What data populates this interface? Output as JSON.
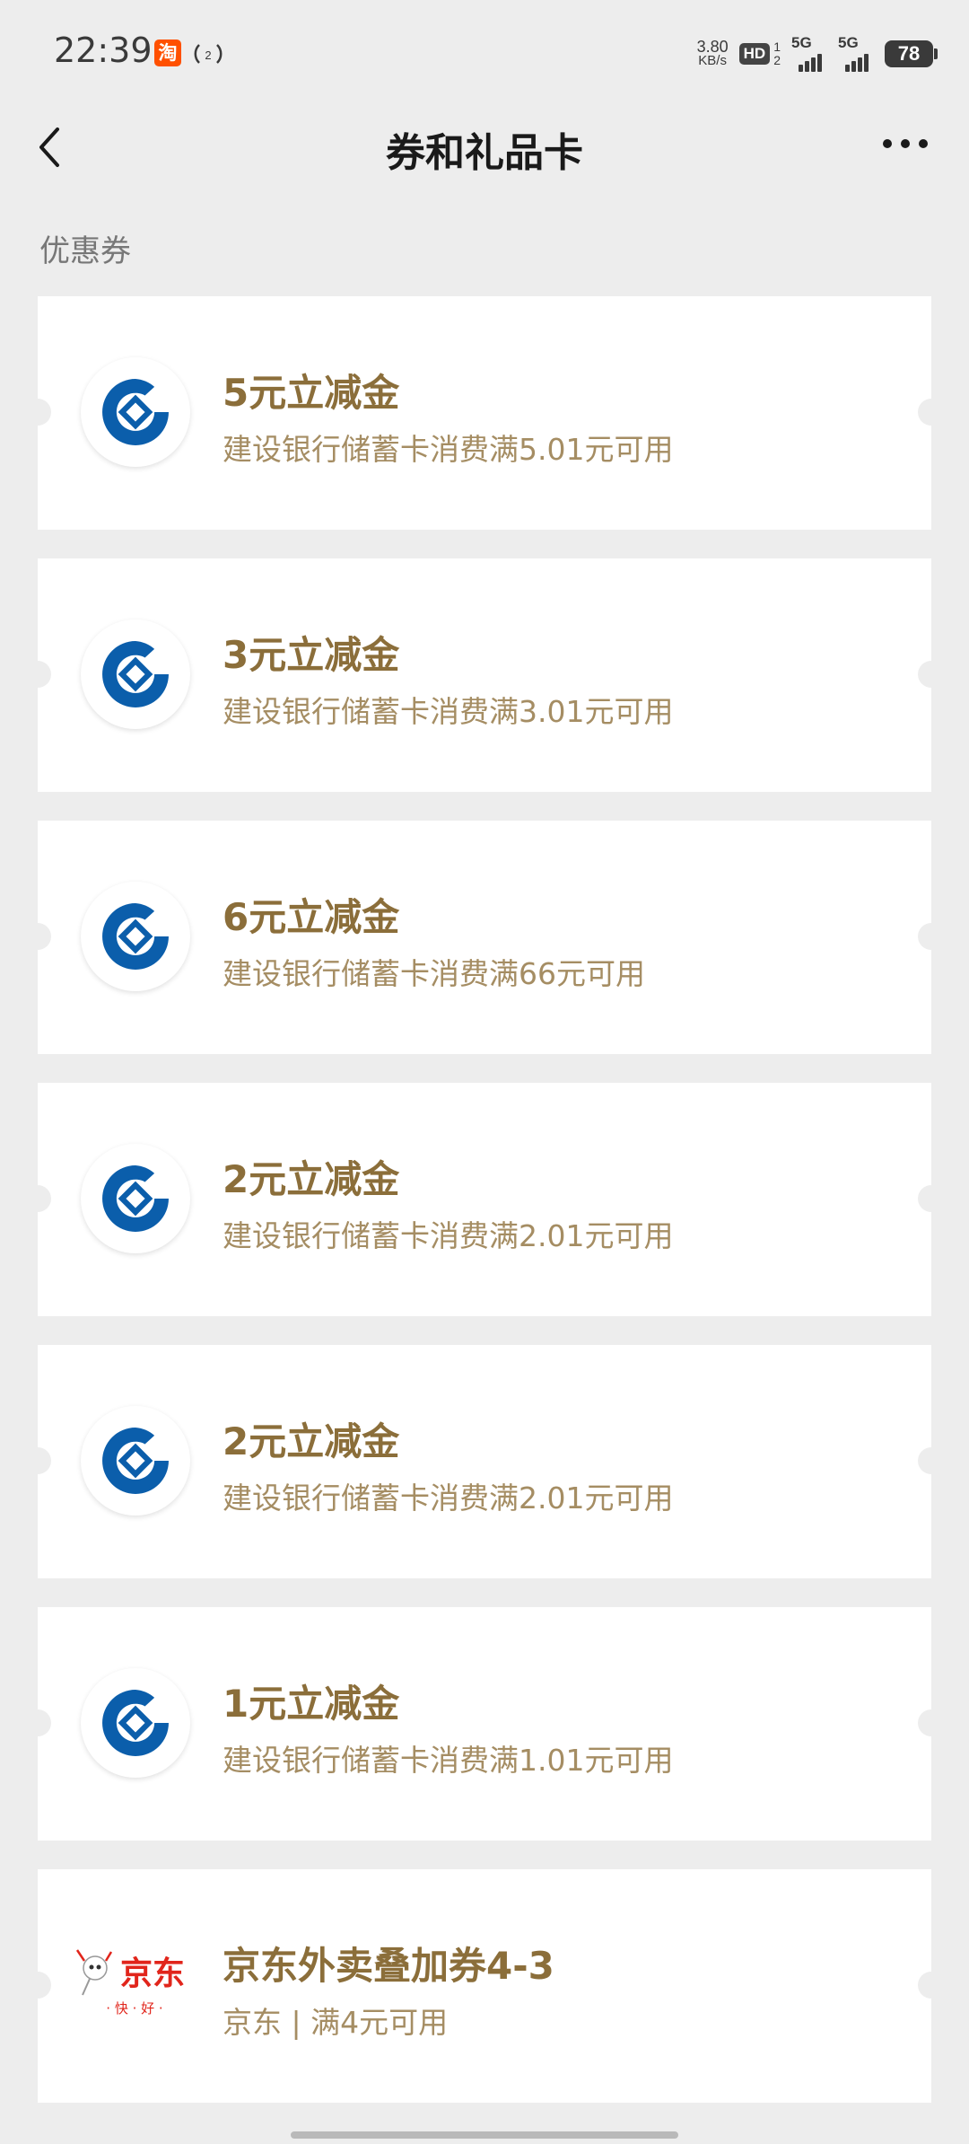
{
  "status_bar": {
    "time": "22:39",
    "app_badge": "淘",
    "net_speed_value": "3.80",
    "net_speed_unit": "KB/s",
    "hd_label": "HD",
    "sim_top": "1",
    "sim_bottom": "2",
    "sim1_gen": "5G",
    "sim2_gen": "5G",
    "battery": "78"
  },
  "nav": {
    "title": "券和礼品卡"
  },
  "section": {
    "label": "优惠券"
  },
  "coupons": [
    {
      "title": "5元立减金",
      "desc": "建设银行储蓄卡消费满5.01元可用",
      "logo": "ccb-icon"
    },
    {
      "title": "3元立减金",
      "desc": "建设银行储蓄卡消费满3.01元可用",
      "logo": "ccb-icon"
    },
    {
      "title": "6元立减金",
      "desc": "建设银行储蓄卡消费满66元可用",
      "logo": "ccb-icon"
    },
    {
      "title": "2元立减金",
      "desc": "建设银行储蓄卡消费满2.01元可用",
      "logo": "ccb-icon"
    },
    {
      "title": "2元立减金",
      "desc": "建设银行储蓄卡消费满2.01元可用",
      "logo": "ccb-icon"
    },
    {
      "title": "1元立减金",
      "desc": "建设银行储蓄卡消费满1.01元可用",
      "logo": "ccb-icon"
    },
    {
      "title": "京东外卖叠加券4-3",
      "desc": "京东 | 满4元可用",
      "logo": "jd-icon",
      "logo_text": "京东",
      "logo_slogan": "· 快 · 好 ·"
    }
  ],
  "colors": {
    "background": "#ededed",
    "coupon_title": "#8b6e3a",
    "coupon_desc": "#a58d63",
    "ccb_blue": "#0b5eab",
    "jd_red": "#e1251b"
  }
}
